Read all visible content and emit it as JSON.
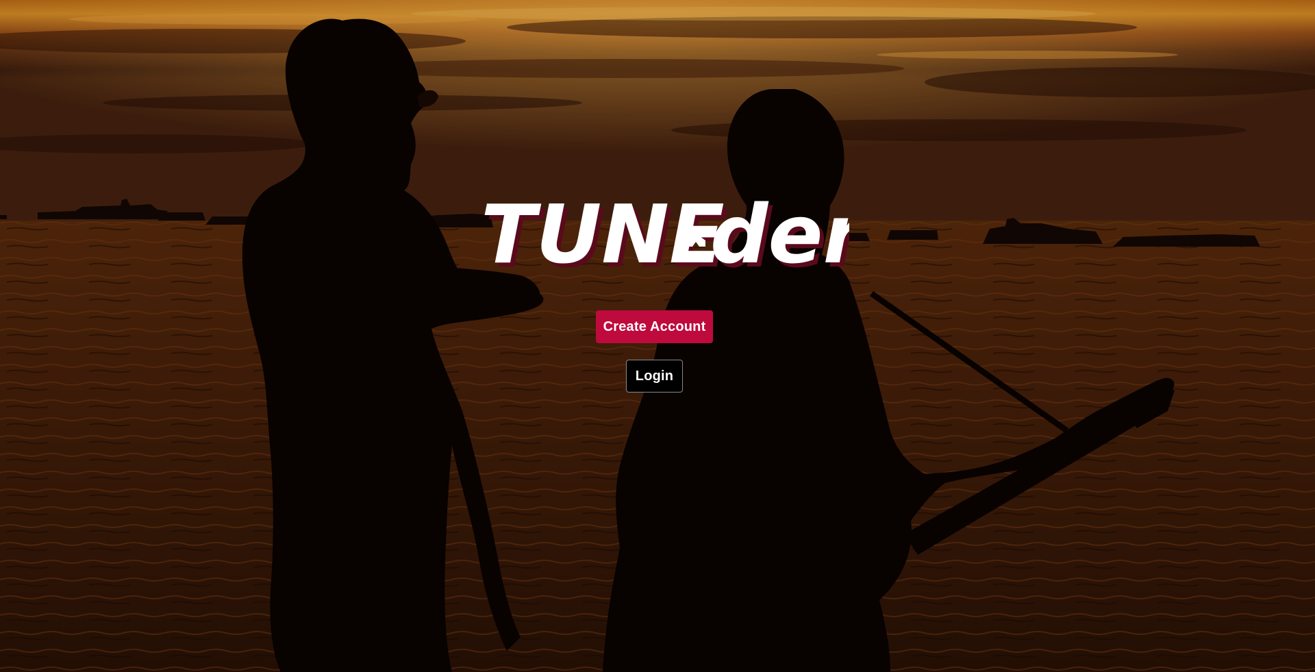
{
  "app": {
    "logo_text_left": "TUNE",
    "logo_text_right": "der",
    "logo_icon": "guitar-pick-cross-icon"
  },
  "actions": {
    "create_account_label": "Create Account",
    "login_label": "Login"
  },
  "colors": {
    "brand_red": "#be0a3c",
    "login_bg": "#000000",
    "sky_orange": "#e8901c",
    "water_brown": "#5a2a0a"
  },
  "background": {
    "scene": "sunset-beach-silhouette-photo"
  }
}
